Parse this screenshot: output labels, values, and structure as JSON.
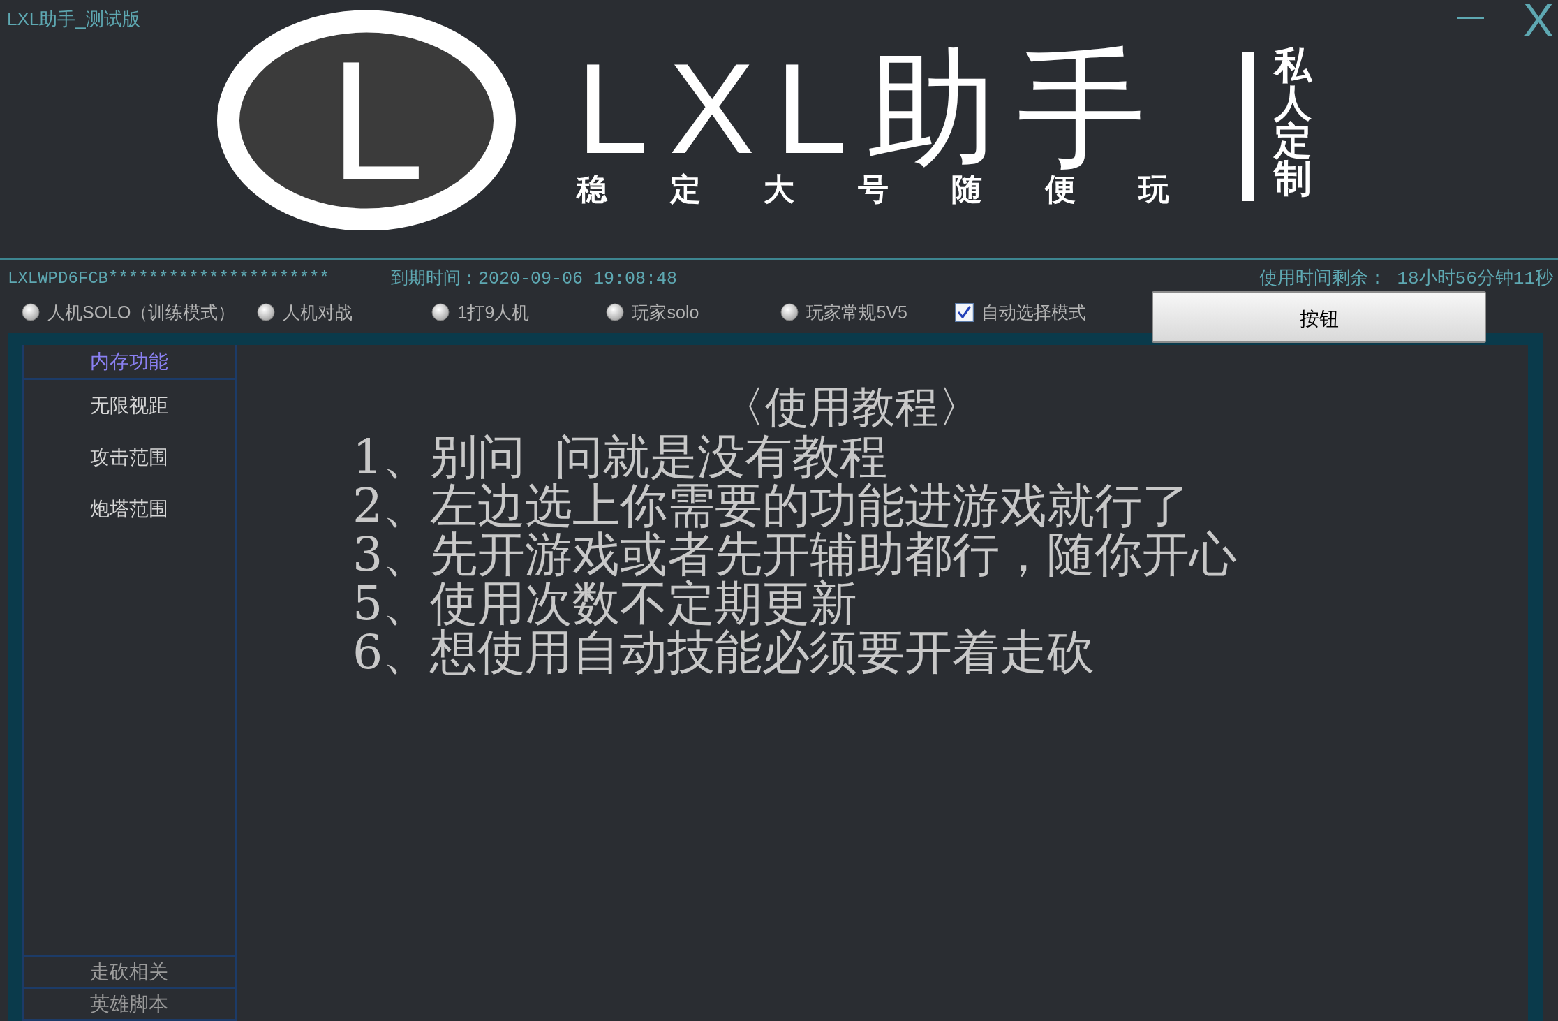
{
  "window": {
    "title": "LXL助手_测试版",
    "minimize": "—",
    "close": "X"
  },
  "banner": {
    "logo_letter": "L",
    "title": "LXL助手",
    "slogan": "稳 定 大 号 随 便 玩",
    "tagline": "私人定制"
  },
  "info": {
    "license_key": "LXLWPD6FCB**********************",
    "expiry": "到期时间：2020-09-06 19:08:48",
    "remaining": "使用时间剩余： 18小时56分钟11秒"
  },
  "modes": [
    {
      "kind": "radio",
      "label": "人机SOLO（训练模式）",
      "selected": false
    },
    {
      "kind": "radio",
      "label": "人机对战",
      "selected": false
    },
    {
      "kind": "radio",
      "label": "1打9人机",
      "selected": false
    },
    {
      "kind": "radio",
      "label": "玩家solo",
      "selected": false
    },
    {
      "kind": "radio",
      "label": "玩家常规5V5",
      "selected": false
    },
    {
      "kind": "checkbox",
      "label": "自动选择模式",
      "checked": true
    }
  ],
  "button": "按钮",
  "sidebar": {
    "groups": [
      {
        "label": "内存功能",
        "selected": true,
        "items": [
          "无限视距",
          "攻击范围",
          "炮塔范围"
        ]
      },
      {
        "label": "走砍相关",
        "selected": false
      },
      {
        "label": "英雄脚本",
        "selected": false
      }
    ]
  },
  "content": {
    "heading": "〈使用教程〉",
    "lines": [
      "1、别问  问就是没有教程",
      "2、左边选上你需要的功能进游戏就行了",
      "3、先开游戏或者先开辅助都行，随你开心",
      "5、使用次数不定期更新",
      "6、想使用自动技能必须要开着走砍"
    ]
  }
}
